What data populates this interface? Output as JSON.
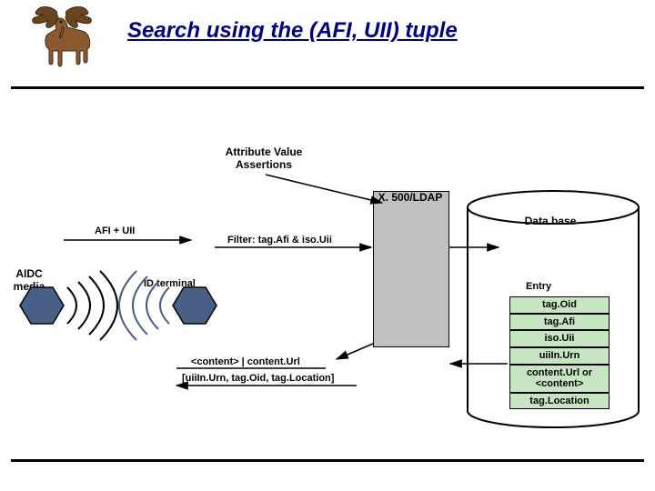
{
  "title": "Search using the (AFI, UII) tuple",
  "ava_label": "Attribute Value Assertions",
  "ldap_label": "X. 500/LDAP",
  "db_label": "Data base",
  "afi_uii_label": "AFI + UII",
  "filter_label": "Filter: tag.Afi & iso.Uii",
  "aidc_label": "AIDC media",
  "id_terminal_label": "ID terminal",
  "content_label": "<content> | content.Url",
  "uii_urn_label": "[uiiIn.Urn, tag.Oid, tag.Location]",
  "entry_label": "Entry",
  "entry_attrs": [
    "tag.Oid",
    "tag.Afi",
    "iso.Uii",
    "uiiIn.Urn",
    "content.Url or <content>",
    "tag.Location"
  ]
}
